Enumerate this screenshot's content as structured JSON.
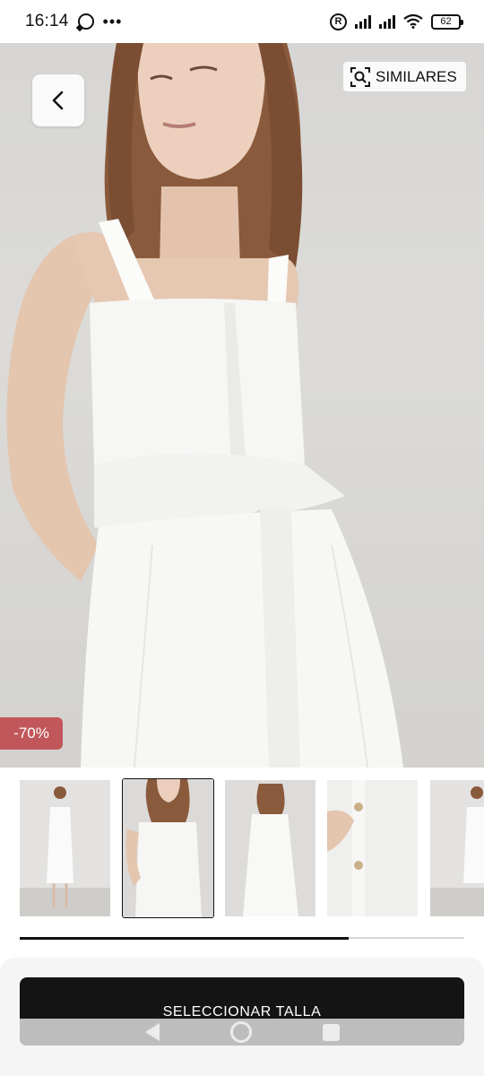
{
  "status_bar": {
    "time": "16:14",
    "battery": "62"
  },
  "hero": {
    "similar_label": "SIMILARES",
    "discount_badge": "-70%"
  },
  "gallery": {
    "thumbnail_count": 5,
    "active_index": 1,
    "scroll_progress": 0.74
  },
  "cta": {
    "label": "SELECCIONAR TALLA"
  },
  "colors": {
    "discount": "#c1575a",
    "cta_background": "#141414",
    "photo_background": "#d8d7d5"
  }
}
